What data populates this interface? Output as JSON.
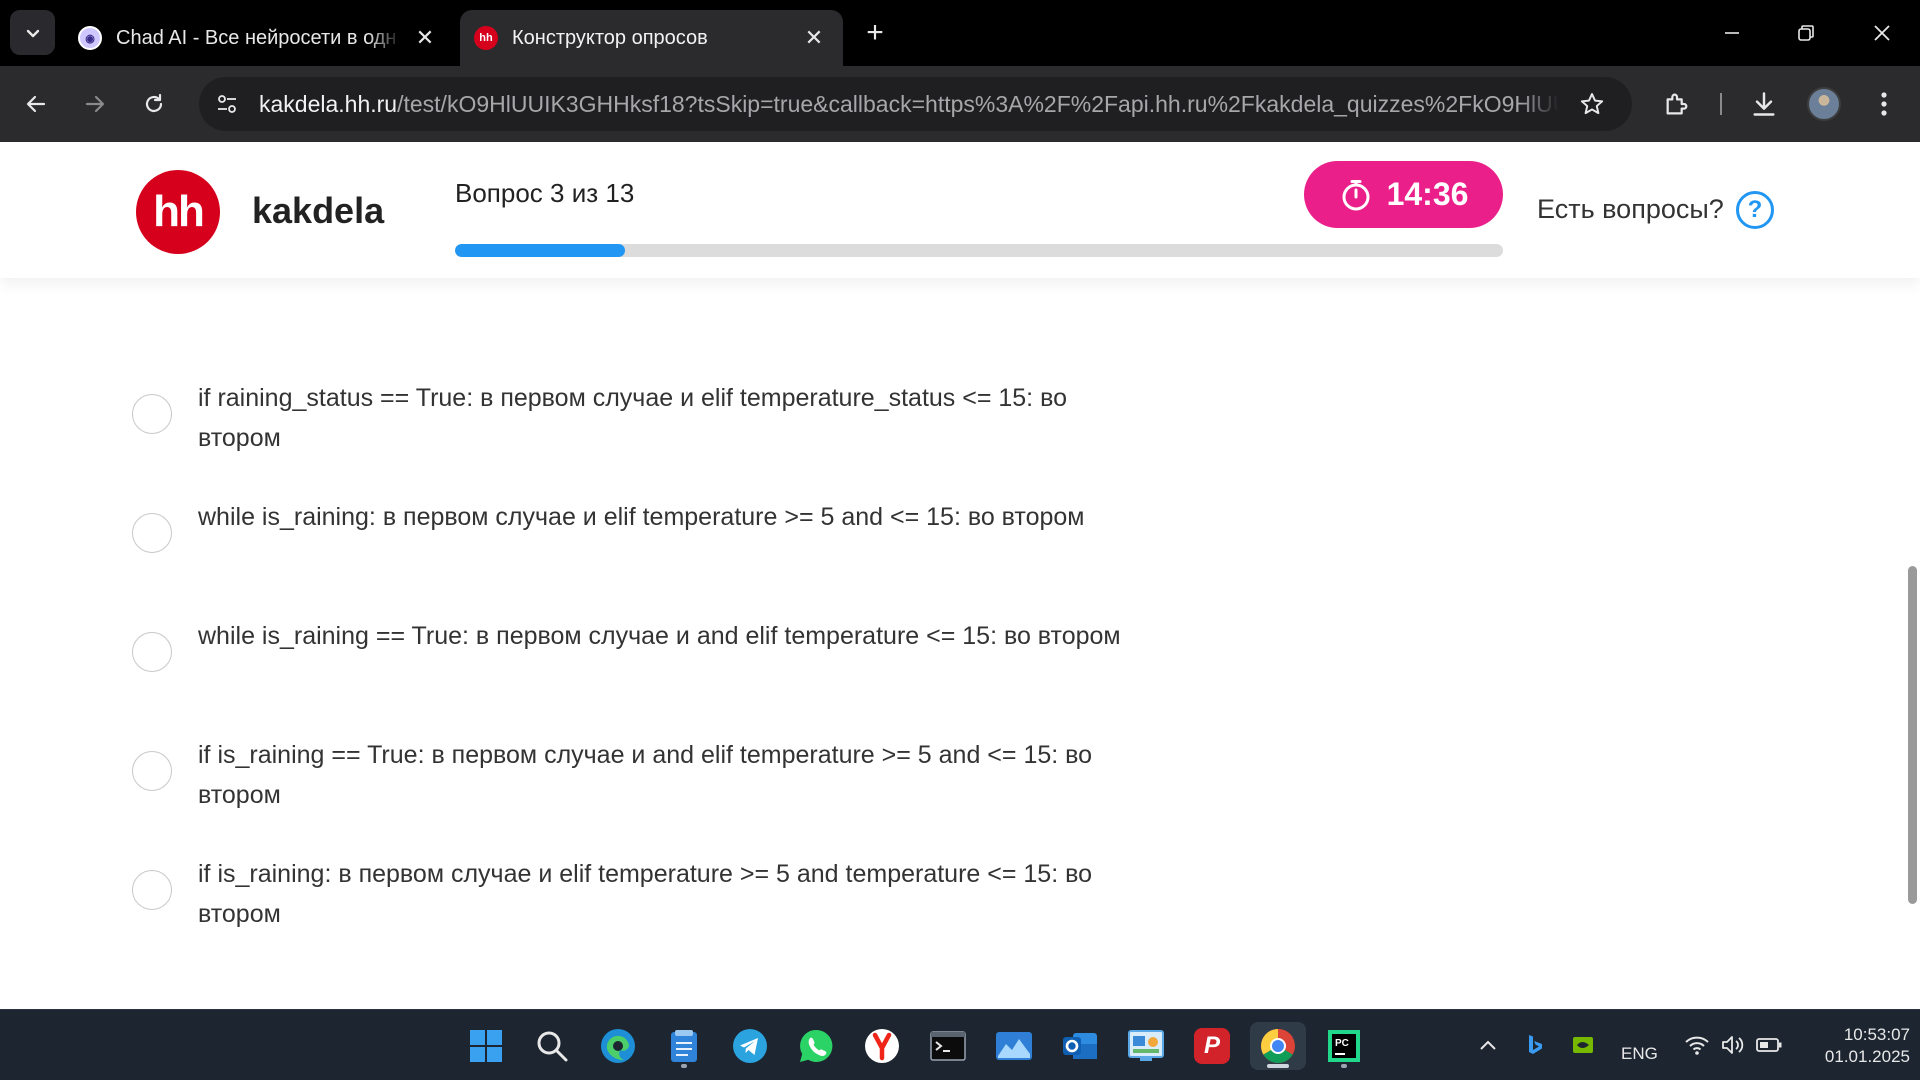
{
  "browser": {
    "tabs": [
      {
        "title": "Chad AI - Все нейросети в одн",
        "close": "✕"
      },
      {
        "title": "Конструктор опросов",
        "close": "✕",
        "favicon_text": "hh"
      }
    ],
    "new_tab": "+",
    "url_host": "kakdela.hh.ru",
    "url_path": "/test/kO9HlUUIK3GHHksf18?tsSkip=true&callback=https%3A%2F%2Fapi.hh.ru%2Fkakdela_quizzes%2FkO9HlUUI..."
  },
  "header": {
    "logo_text": "hh",
    "brand": "kakdela",
    "question_counter": "Вопрос 3 из 13",
    "progress_fraction": 0.1625,
    "timer": "14:36",
    "help_text": "Есть вопросы?",
    "help_icon_text": "?"
  },
  "options": [
    {
      "text": "if raining_status == True: в первом случае и elif temperature_status <= 15: во втором"
    },
    {
      "text": "while is_raining: в первом случае и elif temperature >= 5 and <= 15: во втором"
    },
    {
      "text": "while is_raining == True: в первом случае и and elif temperature <= 15: во втором"
    },
    {
      "text": "if is_raining == True: в первом случае и and elif temperature >= 5 and <= 15: во втором"
    },
    {
      "text": "if is_raining: в первом случае и elif temperature >= 5 and temperature <= 15: во втором"
    }
  ],
  "taskbar": {
    "language": "ENG",
    "time": "10:53:07",
    "date": "01.01.2025",
    "apps": [
      "windows-start",
      "search",
      "edge",
      "notepad",
      "telegram",
      "whatsapp",
      "yandex-browser",
      "terminal",
      "photos",
      "outlook",
      "control-panel",
      "psiphon",
      "chrome",
      "pycharm"
    ]
  },
  "colors": {
    "brand_red": "#d6001c",
    "timer_pink": "#eb1f8a",
    "progress_blue": "#2196f3"
  }
}
